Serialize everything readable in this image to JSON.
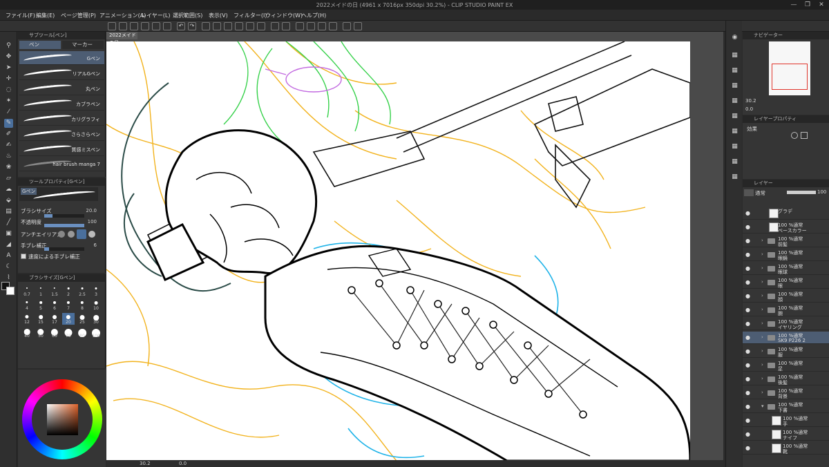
{
  "window": {
    "title": "2022メイドの日 (4961 x 7016px 350dpi 30.2%)  - CLIP STUDIO PAINT EX",
    "controls": [
      "—",
      "❐",
      "✕"
    ]
  },
  "menu": [
    "ファイル(F)",
    "編集(E)",
    "ページ管理(P)",
    "アニメーション(A)",
    "レイヤー(L)",
    "選択範囲(S)",
    "表示(V)",
    "フィルター(I)",
    "ウィンドウ(W)",
    "ヘルプ(H)"
  ],
  "document_tab": "2022メイドの日",
  "subtool": {
    "panel_title": "サブツール[ペン]",
    "tabs": [
      "ペン",
      "マーカー"
    ],
    "brushes": [
      "Gペン",
      "リアルGペン",
      "丸ペン",
      "カブラペン",
      "カリグラフィ",
      "さらさらペン",
      "質感ミスペン",
      "hair brush manga 7"
    ]
  },
  "tool_property": {
    "panel_title": "ツールプロパティ[Gペン]",
    "current": "Gペン",
    "rows": [
      {
        "label": "ブラシサイズ",
        "value": "20.0",
        "fill": 0.2
      },
      {
        "label": "不透明度",
        "value": "100",
        "fill": 1.0
      },
      {
        "label": "アンチエイリアス",
        "value": ""
      },
      {
        "label": "手ブレ補正",
        "value": "6",
        "fill": 0.12
      },
      {
        "label": "速度による手ブレ補正",
        "value": ""
      }
    ]
  },
  "brush_size": {
    "panel_title": "ブラシサイズ[Gペン]",
    "sizes": [
      "0.7",
      "1",
      "1.5",
      "2",
      "2.5",
      "3",
      "4",
      "5",
      "6",
      "7",
      "8",
      "10",
      "12",
      "15",
      "17",
      "20",
      "25",
      "30",
      "40",
      "50",
      "60",
      "70",
      "80",
      "100"
    ],
    "selected": "20"
  },
  "canvas_status": {
    "zoom": "30.2",
    "angle": "0.0"
  },
  "navigator": {
    "panel_title": "ナビゲーター",
    "zoom": "30.2",
    "angle": "0.0"
  },
  "layer_property": {
    "panel_title": "レイヤープロパティ",
    "effect_label": "効果"
  },
  "layers": {
    "panel_title": "レイヤー",
    "blend_mode": "通常",
    "opacity": "100",
    "rows": [
      {
        "l1": "グラデ",
        "l2": "",
        "type": "thumb"
      },
      {
        "l1": "100 %通常",
        "l2": "ベースカラー",
        "type": "thumb"
      },
      {
        "l1": "100 %通常",
        "l2": "前髪",
        "type": "folder"
      },
      {
        "l1": "100 %通常",
        "l2": "眼鏡",
        "type": "folder"
      },
      {
        "l1": "100 %通常",
        "l2": "眼球",
        "type": "folder"
      },
      {
        "l1": "100 %通常",
        "l2": "眼",
        "type": "folder"
      },
      {
        "l1": "100 %通常",
        "l2": "顔",
        "type": "folder"
      },
      {
        "l1": "100 %通常",
        "l2": "腕",
        "type": "folder"
      },
      {
        "l1": "100 %通常",
        "l2": "イヤリング",
        "type": "folder"
      },
      {
        "l1": "100 %通常",
        "l2": "SK9 P226 2",
        "type": "folder",
        "selected": true
      },
      {
        "l1": "100 %通常",
        "l2": "服",
        "type": "folder"
      },
      {
        "l1": "100 %通常",
        "l2": "足",
        "type": "folder"
      },
      {
        "l1": "100 %通常",
        "l2": "後髪",
        "type": "folder"
      },
      {
        "l1": "100 %通常",
        "l2": "背景",
        "type": "folder"
      },
      {
        "l1": "100 %通常",
        "l2": "下書",
        "type": "folder-open"
      },
      {
        "l1": "100 %通常",
        "l2": "手",
        "type": "thumb",
        "child": true
      },
      {
        "l1": "100 %通常",
        "l2": "ナイフ",
        "type": "thumb",
        "child": true
      },
      {
        "l1": "100 %通常",
        "l2": "靴",
        "type": "thumb",
        "child": true
      }
    ]
  },
  "colors": {
    "accent": "#4a6f9c",
    "panel": "#353535",
    "sketch_orange": "#f2b21b",
    "sketch_green": "#36d14a",
    "sketch_blue": "#1fb3e8",
    "sketch_purple": "#c26ae0"
  }
}
